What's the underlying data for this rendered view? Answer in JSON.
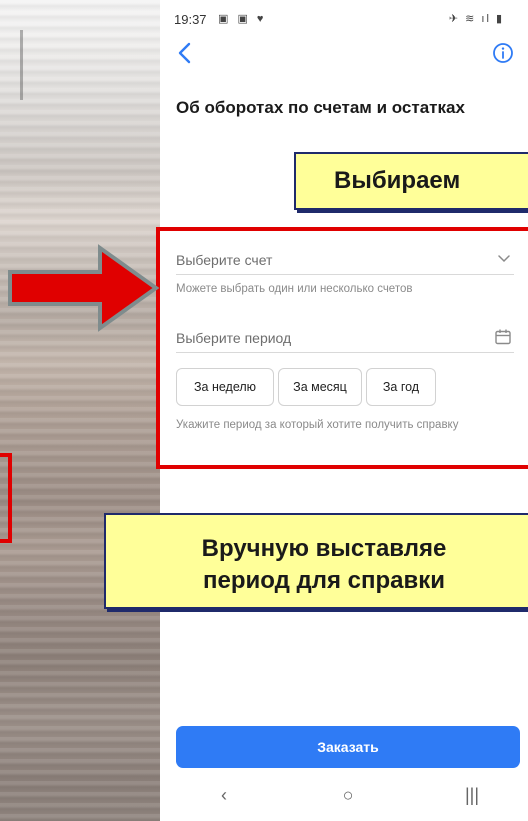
{
  "status_bar": {
    "time": "19:37",
    "left_icons": "▣ ▣ ♥",
    "right_icons": "✈ ≋ ıl ▮"
  },
  "header": {
    "back_icon": "chevron-left-icon",
    "info_icon": "info-circle-icon",
    "title": "Об оборотах по счетам и остатках"
  },
  "form": {
    "account_select": {
      "placeholder": "Выберите счет",
      "hint": "Можете выбрать один или несколько счетов",
      "trail_icon": "chevron-down-icon"
    },
    "period_select": {
      "placeholder": "Выберите период",
      "trail_icon": "calendar-icon",
      "chips": [
        "За неделю",
        "За месяц",
        "За год"
      ],
      "hint": "Укажите период за который хотите получить справку"
    }
  },
  "actions": {
    "order_label": "Заказать"
  },
  "nav_bar": {
    "back": "‹",
    "home": "○",
    "recent": "|||"
  },
  "annotations": {
    "top_callout": "Выбираем",
    "bottom_callout_line1": "Вручную выставляе",
    "bottom_callout_line2": "период для справки",
    "accent_color": "#e00000",
    "callout_fill": "#ffff99"
  }
}
